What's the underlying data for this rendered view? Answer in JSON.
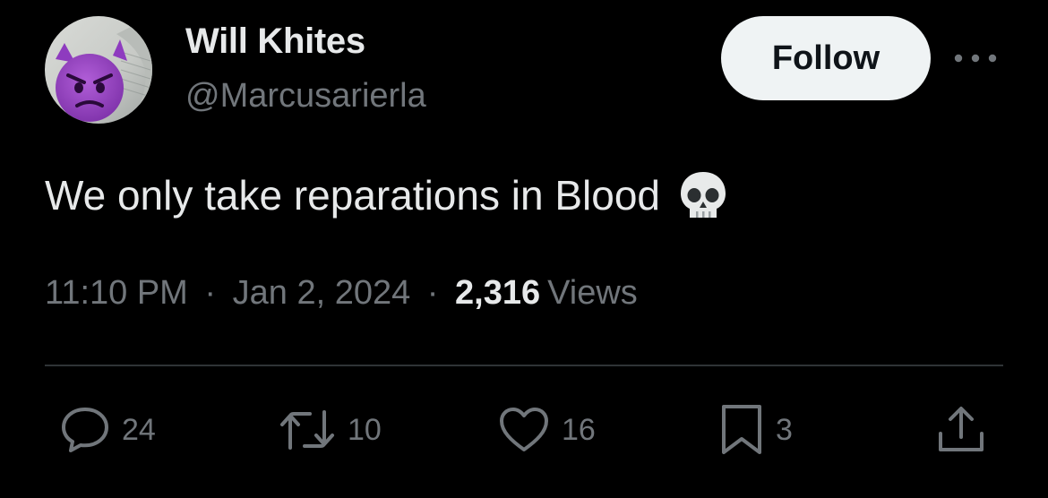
{
  "author": {
    "display_name": "Will Khites",
    "handle": "@Marcusarierla",
    "avatar_icon": "smiling-devil-emoji-avatar"
  },
  "follow_label": "Follow",
  "more_icon": "more-horizontal-icon",
  "tweet": {
    "text": "We only take reparations in Blood",
    "emoji_icon": "skull-emoji"
  },
  "meta": {
    "time": "11:10 PM",
    "separator": "·",
    "date": "Jan 2, 2024",
    "views_count": "2,316",
    "views_label": "Views"
  },
  "actions": {
    "reply": {
      "icon": "reply-icon",
      "count": "24"
    },
    "retweet": {
      "icon": "retweet-icon",
      "count": "10"
    },
    "like": {
      "icon": "heart-icon",
      "count": "16"
    },
    "bookmark": {
      "icon": "bookmark-icon",
      "count": "3"
    },
    "share": {
      "icon": "share-icon"
    }
  },
  "colors": {
    "background": "#000000",
    "primary_text": "#e7e9ea",
    "secondary_text": "#71767b",
    "divider": "#2f3336",
    "follow_bg": "#eff3f4"
  }
}
